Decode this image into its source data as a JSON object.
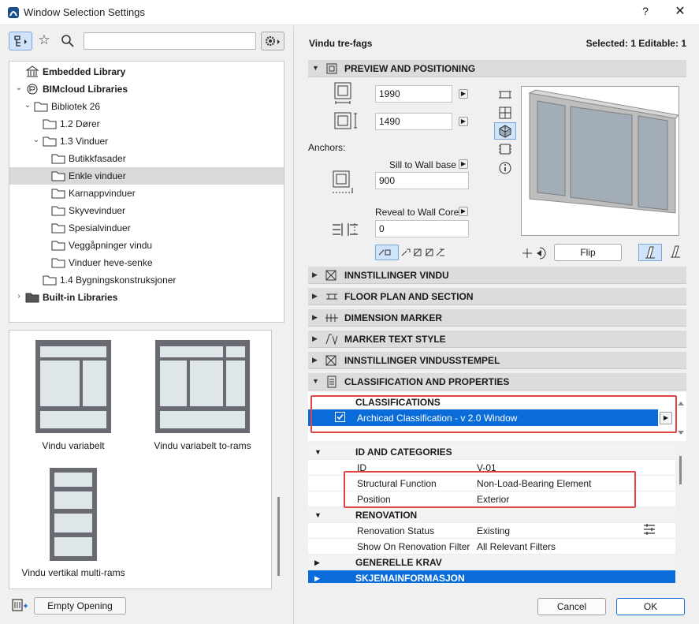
{
  "window": {
    "title": "Window Selection Settings",
    "help": "?",
    "close": "✕"
  },
  "left": {
    "search_placeholder": "",
    "tree": [
      {
        "label": "Embedded Library",
        "bold": true,
        "level": 0,
        "arrow": "",
        "icon": "library"
      },
      {
        "label": "BIMcloud Libraries",
        "bold": true,
        "level": 0,
        "arrow": "down",
        "icon": "bimcloud"
      },
      {
        "label": "Bibliotek 26",
        "bold": false,
        "level": 1,
        "arrow": "down",
        "icon": "folder"
      },
      {
        "label": "1.2 Dører",
        "bold": false,
        "level": 2,
        "arrow": "",
        "icon": "folder"
      },
      {
        "label": "1.3 Vinduer",
        "bold": false,
        "level": 2,
        "arrow": "down",
        "icon": "folder"
      },
      {
        "label": "Butikkfasader",
        "bold": false,
        "level": 3,
        "arrow": "",
        "icon": "folder"
      },
      {
        "label": "Enkle vinduer",
        "bold": false,
        "level": 3,
        "arrow": "",
        "icon": "folder",
        "selected": true
      },
      {
        "label": "Karnappvinduer",
        "bold": false,
        "level": 3,
        "arrow": "",
        "icon": "folder"
      },
      {
        "label": "Skyvevinduer",
        "bold": false,
        "level": 3,
        "arrow": "",
        "icon": "folder"
      },
      {
        "label": "Spesialvinduer",
        "bold": false,
        "level": 3,
        "arrow": "",
        "icon": "folder"
      },
      {
        "label": "Veggåpninger vindu",
        "bold": false,
        "level": 3,
        "arrow": "",
        "icon": "folder"
      },
      {
        "label": "Vinduer heve-senke",
        "bold": false,
        "level": 3,
        "arrow": "",
        "icon": "folder"
      },
      {
        "label": "1.4 Bygningskonstruksjoner",
        "bold": false,
        "level": 2,
        "arrow": "",
        "icon": "folder"
      },
      {
        "label": "Built-in Libraries",
        "bold": true,
        "level": 0,
        "arrow": "right",
        "icon": "folder-dark"
      }
    ],
    "thumbs": [
      {
        "caption": "Vindu variabelt"
      },
      {
        "caption": "Vindu variabelt to-rams"
      },
      {
        "caption": "Vindu vertikal multi-rams"
      }
    ],
    "empty_opening": "Empty Opening"
  },
  "right": {
    "object_name": "Vindu tre-fags",
    "selection_info": "Selected: 1 Editable: 1",
    "panels": {
      "preview": "PREVIEW AND POSITIONING",
      "innstillinger_vindu": "INNSTILLINGER VINDU",
      "floor_plan": "FLOOR PLAN AND SECTION",
      "dimension": "DIMENSION MARKER",
      "marker_text": "MARKER TEXT STYLE",
      "vindusstempel": "INNSTILLINGER VINDUSSTEMPEL",
      "classification": "CLASSIFICATION AND PROPERTIES"
    },
    "width_value": "1990",
    "height_value": "1490",
    "anchors_label": "Anchors:",
    "sill_label": "Sill to Wall base",
    "sill_value": "900",
    "reveal_label": "Reveal to Wall Core",
    "reveal_value": "0",
    "flip": "Flip",
    "classifications": {
      "header": "CLASSIFICATIONS",
      "item": "Archicad Classification - v 2.0 Window"
    },
    "properties": [
      {
        "type": "head",
        "key": "ID AND CATEGORIES"
      },
      {
        "type": "row",
        "key": "ID",
        "value": "V-01"
      },
      {
        "type": "row",
        "key": "Structural Function",
        "value": "Non-Load-Bearing Element"
      },
      {
        "type": "row",
        "key": "Position",
        "value": "Exterior"
      },
      {
        "type": "head",
        "key": "RENOVATION"
      },
      {
        "type": "row",
        "key": "Renovation Status",
        "value": "Existing"
      },
      {
        "type": "row",
        "key": "Show On Renovation Filter",
        "value": "All Relevant Filters"
      },
      {
        "type": "head",
        "key": "GENERELLE KRAV"
      },
      {
        "type": "head-sel",
        "key": "SKJEMAINFORMASJON"
      }
    ],
    "cancel": "Cancel",
    "ok": "OK"
  }
}
